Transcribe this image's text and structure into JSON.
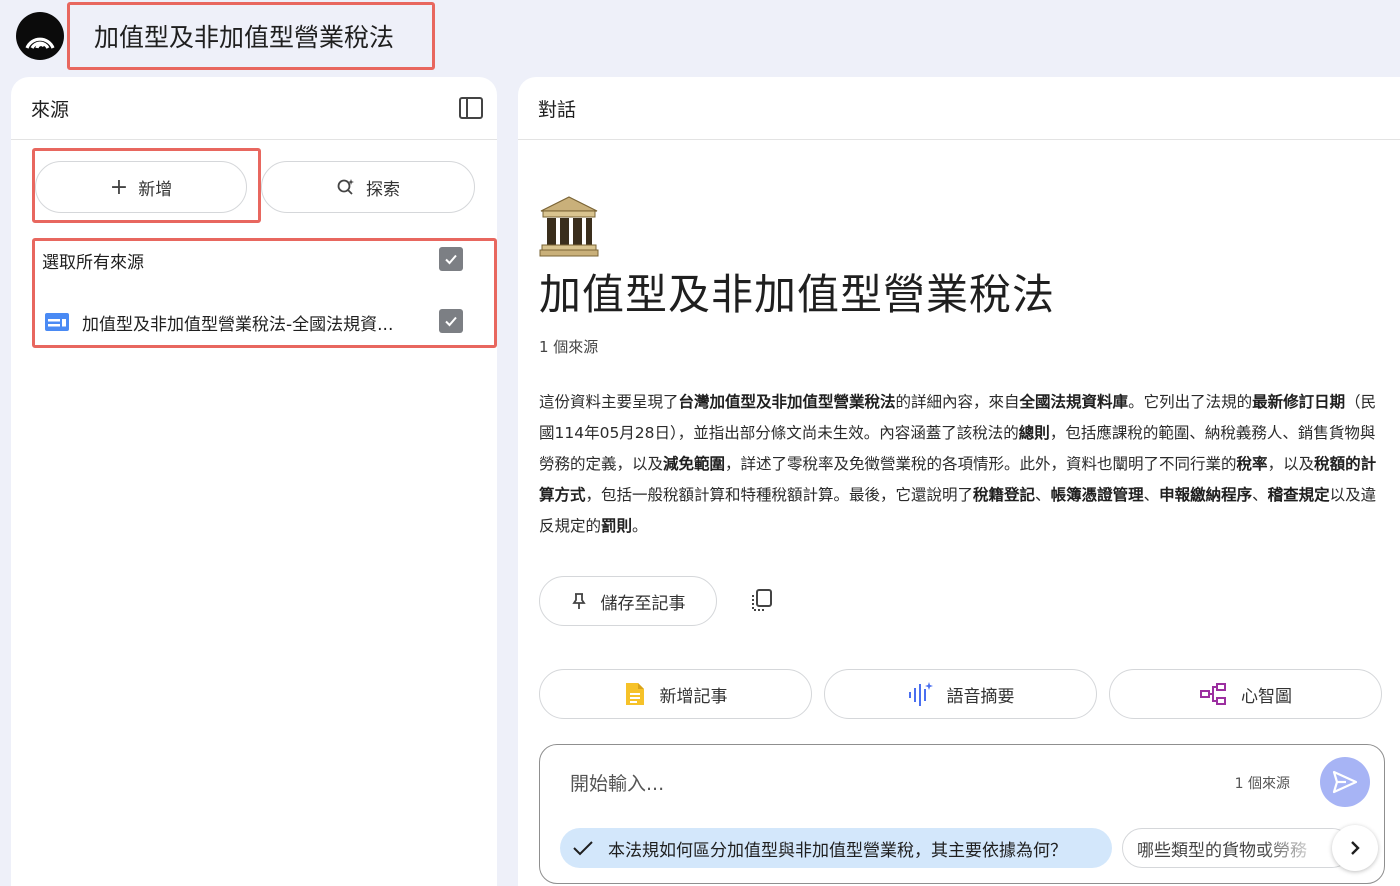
{
  "header": {
    "notebook_title": "加值型及非加值型營業稅法"
  },
  "sources": {
    "title": "來源",
    "add_label": "新增",
    "explore_label": "探索",
    "select_all_label": "選取所有來源",
    "items": [
      {
        "label": "加值型及非加值型營業稅法-全國法規資..."
      }
    ]
  },
  "chat": {
    "title": "對話",
    "notebook_title": "加值型及非加值型營業稅法",
    "source_count": "1 個來源",
    "summary": [
      {
        "t": "這份資料主要呈現了"
      },
      {
        "t": "台灣加值型及非加值型營業稅法",
        "b": true
      },
      {
        "t": "的詳細內容，來自"
      },
      {
        "t": "全國法規資料庫",
        "b": true
      },
      {
        "t": "。它列出了法規的"
      },
      {
        "t": "最新修訂日期",
        "b": true
      },
      {
        "t": "（民國114年05月28日），並指出部分條文尚未生效。內容涵蓋了該稅法的"
      },
      {
        "t": "總則",
        "b": true
      },
      {
        "t": "，包括應課稅的範圍、納稅義務人、銷售貨物與勞務的定義，以及"
      },
      {
        "t": "減免範圍",
        "b": true
      },
      {
        "t": "，詳述了零稅率及免徵營業稅的各項情形。此外，資料也闡明了不同行業的"
      },
      {
        "t": "稅率",
        "b": true
      },
      {
        "t": "，以及"
      },
      {
        "t": "稅額的計算方式",
        "b": true
      },
      {
        "t": "，包括一般稅額計算和特種稅額計算。最後，它還說明了"
      },
      {
        "t": "稅籍登記",
        "b": true
      },
      {
        "t": "、"
      },
      {
        "t": "帳簿憑證管理",
        "b": true
      },
      {
        "t": "、"
      },
      {
        "t": "申報繳納程序",
        "b": true
      },
      {
        "t": "、"
      },
      {
        "t": "稽查規定",
        "b": true
      },
      {
        "t": "以及違反規定的"
      },
      {
        "t": "罰則",
        "b": true
      },
      {
        "t": "。"
      }
    ],
    "save_note_label": "儲存至記事",
    "actions": {
      "add_note": "新增記事",
      "audio_overview": "語音摘要",
      "mind_map": "心智圖"
    },
    "input": {
      "placeholder": "開始輸入...",
      "source_count": "1 個來源"
    },
    "suggestions": [
      "本法規如何區分加值型與非加值型營業稅，其主要依據為何？",
      "哪些類型的貨物或勞務"
    ]
  },
  "colors": {
    "highlight_border": "#e8675f",
    "send_button": "#a7b4f5",
    "suggestion_bg": "#d3e7fb"
  }
}
